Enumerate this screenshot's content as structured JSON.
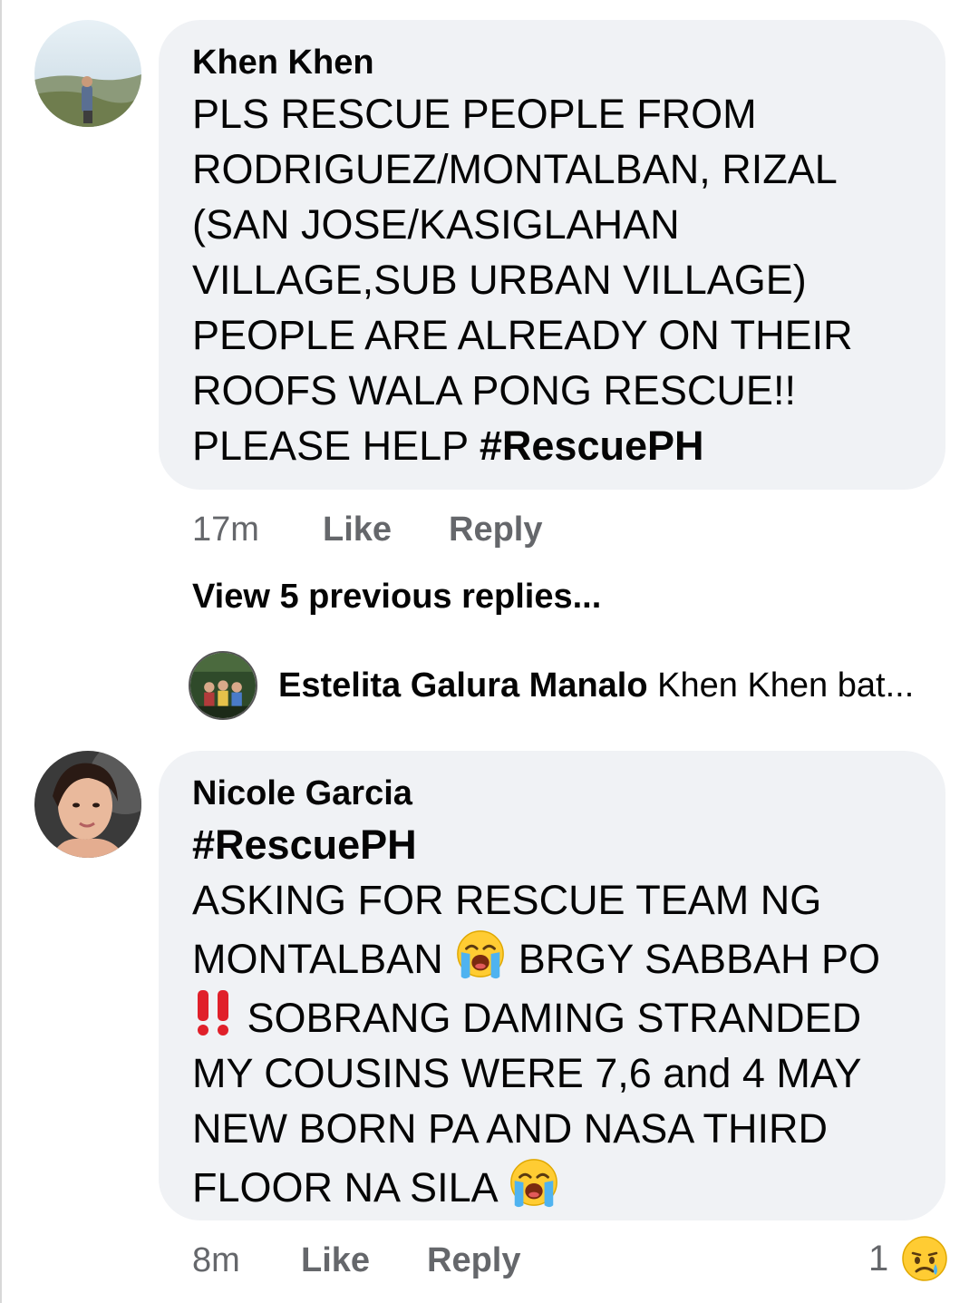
{
  "comments": [
    {
      "author": "Khen Khen",
      "lines": [
        "PLS RESCUE PEOPLE FROM",
        "RODRIGUEZ/MONTALBAN, RIZAL",
        "(SAN JOSE/KASIGLAHAN",
        "VILLAGE,SUB URBAN VILLAGE)",
        "PEOPLE ARE ALREADY ON THEIR",
        "ROOFS WALA PONG RESCUE!!"
      ],
      "last_line_prefix": "PLEASE HELP ",
      "hashtag": "#RescuePH",
      "time": "17m",
      "like": "Like",
      "reply": "Reply",
      "avatar_icon": "profile-photo-landscape"
    },
    {
      "author": "Nicole Garcia",
      "hashtag": "#RescuePH",
      "line1": "ASKING FOR RESCUE TEAM NG",
      "line2_a": "MONTALBAN ",
      "line2_b": " BRGY SABBAH PO",
      "line3": " SOBRANG DAMING STRANDED",
      "line4": "MY COUSINS WERE 7,6 and 4 MAY",
      "line5": "NEW BORN PA AND NASA THIRD",
      "line6": "FLOOR NA SILA ",
      "emoji_icon": "loudly-crying-face-icon",
      "bang_icon": "double-exclamation-icon",
      "time": "8m",
      "like": "Like",
      "reply": "Reply",
      "reaction_count": "1",
      "reaction_icon": "sad-face-icon",
      "avatar_icon": "profile-photo-portrait"
    }
  ],
  "view_previous_replies": "View 5 previous replies...",
  "latest_reply": {
    "author": "Estelita Galura Manalo",
    "snippet": "Khen Khen bat...",
    "avatar_icon": "profile-photo-group"
  },
  "colors": {
    "bubble_bg": "#f0f2f5",
    "meta_text": "#65676b",
    "primary_text": "#050505"
  }
}
